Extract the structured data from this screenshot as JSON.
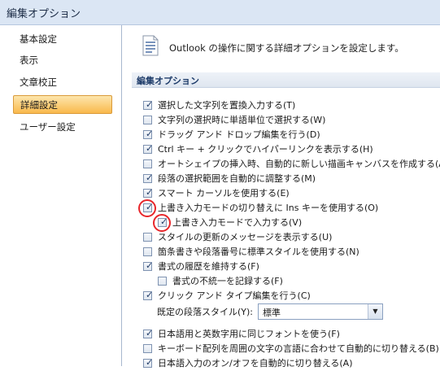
{
  "window": {
    "title": "編集オプション"
  },
  "sidebar": {
    "items": [
      {
        "label": "基本設定",
        "active": false
      },
      {
        "label": "表示",
        "active": false
      },
      {
        "label": "文章校正",
        "active": false
      },
      {
        "label": "詳細設定",
        "active": true
      },
      {
        "label": "ユーザー設定",
        "active": false
      }
    ]
  },
  "header": {
    "icon": "document-settings-icon",
    "text": "Outlook の操作に関する詳細オプションを設定します。"
  },
  "section": {
    "title": "編集オプション"
  },
  "options": [
    {
      "label": "選択した文字列を置換入力する(T)",
      "checked": true
    },
    {
      "label": "文字列の選択時に単語単位で選択する(W)",
      "checked": false
    },
    {
      "label": "ドラッグ アンド ドロップ編集を行う(D)",
      "checked": true
    },
    {
      "label": "Ctrl キー + クリックでハイパーリンクを表示する(H)",
      "checked": true
    },
    {
      "label": "オートシェイプの挿入時、自動的に新しい描画キャンバスを作成する(A)",
      "checked": false
    },
    {
      "label": "段落の選択範囲を自動的に調整する(M)",
      "checked": true
    },
    {
      "label": "スマート カーソルを使用する(E)",
      "checked": true
    },
    {
      "label": "上書き入力モードの切り替えに Ins キーを使用する(O)",
      "checked": true
    },
    {
      "label": "上書き入力モードで入力する(V)",
      "checked": true
    },
    {
      "label": "スタイルの更新のメッセージを表示する(U)",
      "checked": false
    },
    {
      "label": "箇条書きや段落番号に標準スタイルを使用する(N)",
      "checked": false
    },
    {
      "label": "書式の履歴を維持する(F)",
      "checked": true
    },
    {
      "label": "書式の不統一を記録する(F)",
      "checked": false
    },
    {
      "label": "クリック アンド タイプ編集を行う(C)",
      "checked": true
    },
    {
      "label": "日本語用と英数字用に同じフォントを使う(F)",
      "checked": true
    },
    {
      "label": "キーボード配列を周囲の文字の言語に合わせて自動的に切り替える(B)",
      "checked": false
    },
    {
      "label": "日本語入力のオン/オフを自動的に切り替える(A)",
      "checked": true
    }
  ],
  "paragraph_style": {
    "label": "既定の段落スタイル(Y):",
    "value": "標準"
  },
  "colors": {
    "accent": "#f9b94c",
    "highlight": "#e8262b",
    "section_text": "#1e3c6a"
  }
}
